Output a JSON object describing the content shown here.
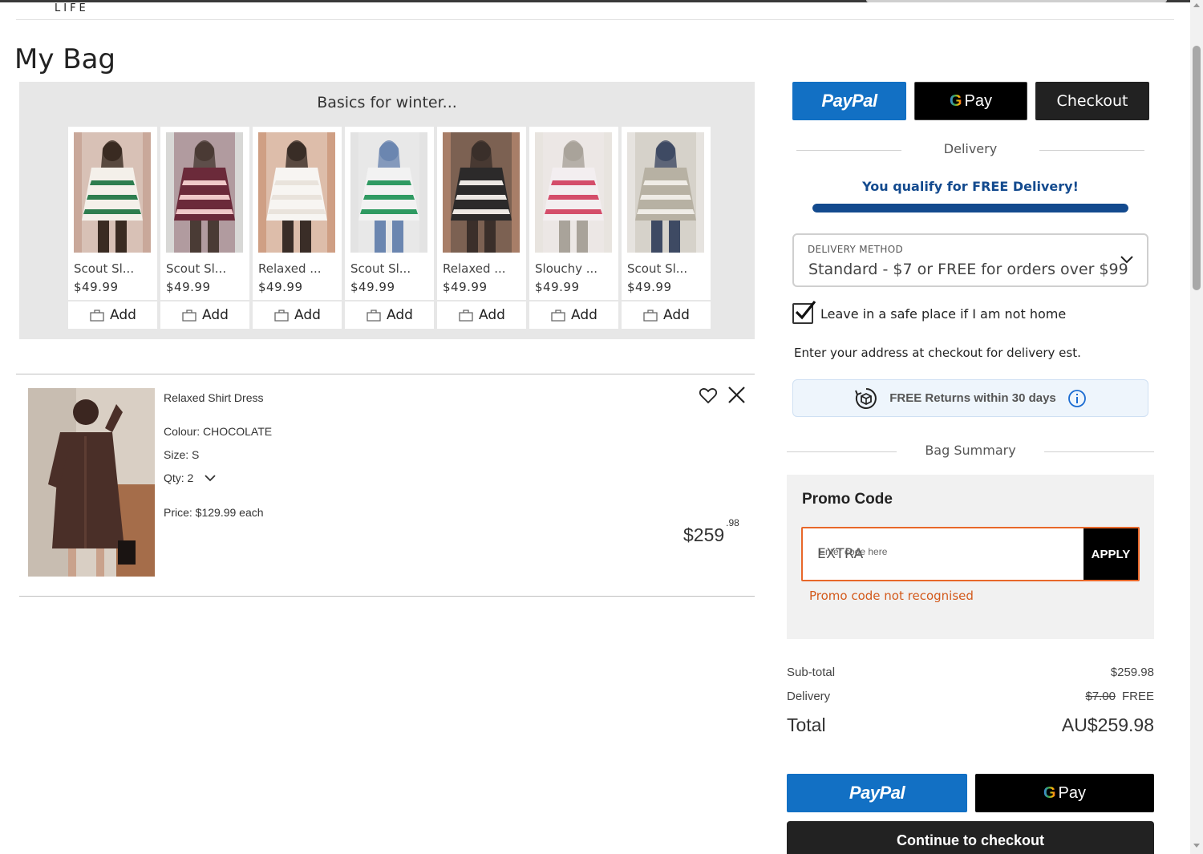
{
  "header": {
    "logo": "LIFE"
  },
  "page_title": "My Bag",
  "recommendations": {
    "title": "Basics for winter...",
    "add_label": "Add",
    "items": [
      {
        "name": "Scout Sl...",
        "price": "$49.99",
        "colors": [
          "#c9a89a",
          "#f4f0ea",
          "#2e7d4f",
          "#3a2b22"
        ]
      },
      {
        "name": "Scout Sl...",
        "price": "$49.99",
        "colors": [
          "#d8d8d6",
          "#6b2a3a",
          "#f0c9c9",
          "#4a3b35"
        ]
      },
      {
        "name": "Relaxed ...",
        "price": "$49.99",
        "colors": [
          "#cf9f84",
          "#f7f5f2",
          "#e9e3dc",
          "#3a2d27"
        ]
      },
      {
        "name": "Scout Sl...",
        "price": "$49.99",
        "colors": [
          "#e3e3e3",
          "#f2f2f2",
          "#2f9a62",
          "#6b86b0"
        ]
      },
      {
        "name": "Relaxed ...",
        "price": "$49.99",
        "colors": [
          "#a87e68",
          "#2c2a2a",
          "#ede8e3",
          "#3b2f2a"
        ]
      },
      {
        "name": "Slouchy ...",
        "price": "$49.99",
        "colors": [
          "#e8e4df",
          "#f3eef0",
          "#d44d6a",
          "#a9a39a"
        ]
      },
      {
        "name": "Scout Sl...",
        "price": "$49.99",
        "colors": [
          "#e6e3df",
          "#b7b1a3",
          "#efece6",
          "#3e4a63"
        ]
      }
    ]
  },
  "cart_item": {
    "name": "Relaxed Shirt Dress",
    "colour": "Colour: CHOCOLATE",
    "size": "Size: S",
    "qty": "Qty: 2",
    "price_each": "Price: $129.99 each",
    "line_total_main": "$259",
    "line_total_cents": ".98",
    "image_colors": [
      "#d9cfc4",
      "#4a2f28",
      "#a56d4a",
      "#3b2620"
    ]
  },
  "payments_top": {
    "paypal": "PayPal",
    "gpay": "Pay",
    "checkout": "Checkout"
  },
  "delivery": {
    "heading": "Delivery",
    "qualify": "You qualify for FREE Delivery!",
    "progress_fraction": 1.0,
    "method_label": "DELIVERY METHOD",
    "method_value": "Standard - $7 or FREE for orders over $99",
    "safe_place": "Leave in a safe place if I am not home",
    "safe_place_checked": true,
    "address_note": "Enter your address at checkout for delivery est.",
    "returns": "FREE Returns within 30 days"
  },
  "bag_summary": {
    "heading": "Bag Summary",
    "promo_title": "Promo Code",
    "promo_value": "EXTRA",
    "promo_placeholder": "Enter code here",
    "apply_label": "APPLY",
    "promo_error": "Promo code not recognised",
    "subtotal_label": "Sub-total",
    "subtotal_value": "$259.98",
    "delivery_label": "Delivery",
    "delivery_old": "$7.00",
    "delivery_value": "FREE",
    "total_label": "Total",
    "total_value": "AU$259.98"
  },
  "payments_bottom": {
    "paypal": "PayPal",
    "gpay": "Pay",
    "checkout": "Continue to checkout"
  },
  "colors": {
    "paypal": "#1270c4",
    "navy": "#134a8e",
    "error": "#d35a1c",
    "promo_border": "#e8682a"
  }
}
